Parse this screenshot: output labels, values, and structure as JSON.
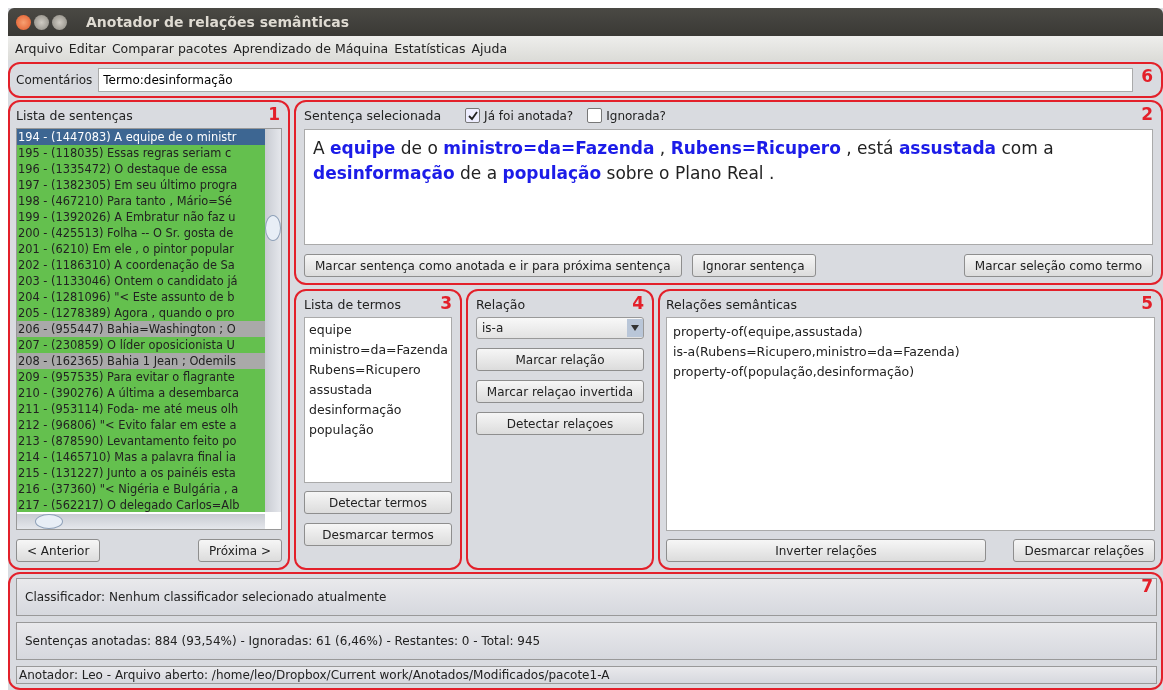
{
  "window": {
    "title": "Anotador de relações semânticas"
  },
  "menu": [
    "Arquivo",
    "Editar",
    "Comparar pacotes",
    "Aprendizado de Máquina",
    "Estatísticas",
    "Ajuda"
  ],
  "comments": {
    "callout": "6",
    "label": "Comentários",
    "value": "Termo:desinformação"
  },
  "sentence_list": {
    "callout": "1",
    "title": "Lista de sentenças",
    "items": [
      {
        "text": "194 - (1447083) A equipe de o ministr",
        "selected": true
      },
      {
        "text": "195 - (118035) Essas regras seriam c",
        "ignored": false,
        "selected": false
      },
      {
        "text": "196 - (1335472) O destaque de essa",
        "ignored": false,
        "selected": false
      },
      {
        "text": "197 - (1382305) Em seu último progra",
        "ignored": false,
        "selected": false
      },
      {
        "text": "198 - (467210) Para tanto , Mário=Sé",
        "ignored": false,
        "selected": false
      },
      {
        "text": "199 - (1392026) A Embratur não faz u",
        "ignored": false,
        "selected": false
      },
      {
        "text": "200 - (425513) Folha -- O Sr. gosta de",
        "ignored": false,
        "selected": false
      },
      {
        "text": "201 - (6210) Em ele , o pintor popular",
        "ignored": false,
        "selected": false
      },
      {
        "text": "202 - (1186310) A coordenação de Sa",
        "ignored": false,
        "selected": false
      },
      {
        "text": "203 - (1133046) Ontem o candidato já",
        "ignored": false,
        "selected": false
      },
      {
        "text": "204 - (1281096) \"< Este assunto de b",
        "ignored": false,
        "selected": false
      },
      {
        "text": "205 - (1278389) Agora , quando o pro",
        "ignored": false,
        "selected": false
      },
      {
        "text": "206 - (955447) Bahia=Washington ; O",
        "ignored": true,
        "selected": false
      },
      {
        "text": "207 - (230859) O líder oposicionista U",
        "ignored": false,
        "selected": false
      },
      {
        "text": "208 - (162365) Bahia 1 Jean ; Odemils",
        "ignored": true,
        "selected": false
      },
      {
        "text": "209 - (957535) Para evitar o flagrante",
        "ignored": false,
        "selected": false
      },
      {
        "text": "210 - (390276) A última a desembarca",
        "ignored": false,
        "selected": false
      },
      {
        "text": "211 - (953114) Foda- me até meus olh",
        "ignored": false,
        "selected": false
      },
      {
        "text": "212 - (96806) \"< Evito falar em este a",
        "ignored": false,
        "selected": false
      },
      {
        "text": "213 - (878590) Levantamento feito po",
        "ignored": false,
        "selected": false
      },
      {
        "text": "214 - (1465710) Mas a palavra final ia",
        "ignored": false,
        "selected": false
      },
      {
        "text": "215 - (131227) Junto a os painéis esta",
        "ignored": false,
        "selected": false
      },
      {
        "text": "216 - (37360) \"< Nigéria e Bulgária , a",
        "ignored": false,
        "selected": false
      },
      {
        "text": "217 - (562217) O delegado Carlos=Alb",
        "ignored": false,
        "selected": false
      }
    ],
    "buttons": [
      "< Anterior",
      "Próxima >"
    ]
  },
  "selected_sentence": {
    "callout": "2",
    "title": "Sentença selecionada",
    "checkboxes": [
      {
        "label": "Já foi anotada?",
        "checked": true
      },
      {
        "label": "Ignorada?",
        "checked": false
      }
    ],
    "segments": [
      {
        "text": "A ",
        "term": false
      },
      {
        "text": "equipe",
        "term": true
      },
      {
        "text": " de o ",
        "term": false
      },
      {
        "text": "ministro=da=Fazenda",
        "term": true
      },
      {
        "text": " , ",
        "term": false
      },
      {
        "text": "Rubens=Ricupero",
        "term": true
      },
      {
        "text": " , está ",
        "term": false
      },
      {
        "text": "assustada",
        "term": true
      },
      {
        "text": " com a ",
        "term": false
      },
      {
        "text": "desinformação",
        "term": true
      },
      {
        "text": " de a ",
        "term": false
      },
      {
        "text": "população",
        "term": true
      },
      {
        "text": " sobre o Plano Real .",
        "term": false
      }
    ],
    "buttons": [
      "Marcar sentença como anotada e ir para próxima sentença",
      "Ignorar sentença",
      "Marcar seleção como termo"
    ]
  },
  "terms": {
    "callout": "3",
    "title": "Lista de termos",
    "items": [
      "equipe",
      "ministro=da=Fazenda",
      "Rubens=Ricupero",
      "assustada",
      "desinformação",
      "população"
    ],
    "buttons": [
      "Detectar termos",
      "Desmarcar termos"
    ]
  },
  "relation": {
    "callout": "4",
    "title": "Relação",
    "value": "is-a",
    "buttons": [
      "Marcar relação",
      "Marcar relaçao invertida",
      "Detectar relaçoes"
    ]
  },
  "semantic_relations": {
    "callout": "5",
    "title": "Relações semânticas",
    "items": [
      "property-of(equipe,assustada)",
      "is-a(Rubens=Ricupero,ministro=da=Fazenda)",
      "property-of(população,desinformação)"
    ],
    "buttons": [
      "Inverter relações",
      "Desmarcar relações"
    ]
  },
  "status": {
    "callout": "7",
    "classifier": "Classificador: Nenhum classificador selecionado atualmente",
    "counts": "Sentenças anotadas: 884 (93,54%) - Ignoradas: 61 (6,46%) - Restantes: 0 - Total: 945",
    "file": "Anotador: Leo - Arquivo aberto: /home/leo/Dropbox/Current work/Anotados/Modificados/pacote1-A"
  }
}
